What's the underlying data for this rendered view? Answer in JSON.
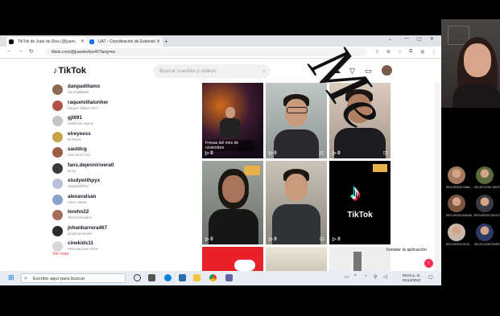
{
  "browser": {
    "tabs": [
      {
        "label": "TikTok de Juan de Dios (@juanc"
      },
      {
        "label": "UAT - Coordinación de Extensió"
      }
    ],
    "new_tab": "+",
    "url": "tiktok.com/@juandedios45?lang=es"
  },
  "tiktok": {
    "logo": "TikTok",
    "search_placeholder": "Buscar cuentas y videos",
    "accounts": [
      {
        "username": "danpadillamx",
        "display": "DanPadillaMX"
      },
      {
        "username": "raquelvillalonher",
        "display": "Raquel Villalon Herr"
      },
      {
        "username": "gjl691",
        "display": "Gabrimon Juarez"
      },
      {
        "username": "elreyeess",
        "display": "El Reyes"
      },
      {
        "username": "sauldcg",
        "display": "Saul de la Cruz"
      },
      {
        "username": "fans.dejennirivera0",
        "display": "jenny"
      },
      {
        "username": "studywithpyx",
        "display": "StudyWithPyx"
      },
      {
        "username": "alexavalsan",
        "display": "Alexa Valsan"
      },
      {
        "username": "terehn22",
        "display": "Tere Hernandez"
      },
      {
        "username": "johanbarrera467",
        "display": "johanbarrera467"
      },
      {
        "username": "cinekids11",
        "display": "Películas para niños"
      }
    ],
    "see_more": "Ver mas",
    "videos": [
      {
        "caption": "Fresas del mes de noviembre",
        "tag": ""
      },
      {
        "caption": "",
        "tag": ""
      },
      {
        "caption": "",
        "tag": ""
      },
      {
        "caption": "",
        "tag": ""
      },
      {
        "caption": "",
        "tag": ""
      },
      {
        "caption": "TikTok",
        "tag": ""
      }
    ],
    "play_counts": [
      "0",
      "0",
      "0",
      "0",
      "0",
      "0"
    ],
    "install_label": "Instalar la aplicación"
  },
  "taskbar": {
    "search_placeholder": "Escribe aquí para buscar",
    "time": "05:04 p. m.",
    "date": "01/12/2021"
  },
  "participants": [
    {
      "name": "RECURSOS TABA..."
    },
    {
      "name": "SELECCIÓN CENTRA..."
    },
    {
      "name": "RECURSOS MEDIA..."
    },
    {
      "name": "RECURSOS SELEC..."
    },
    {
      "name": "RECURSOS RIVE..."
    },
    {
      "name": "SELECCIÓN RIVERA..."
    }
  ],
  "colors": {
    "accent": "#fe2c55",
    "taskbar": "#e8ecf3"
  }
}
